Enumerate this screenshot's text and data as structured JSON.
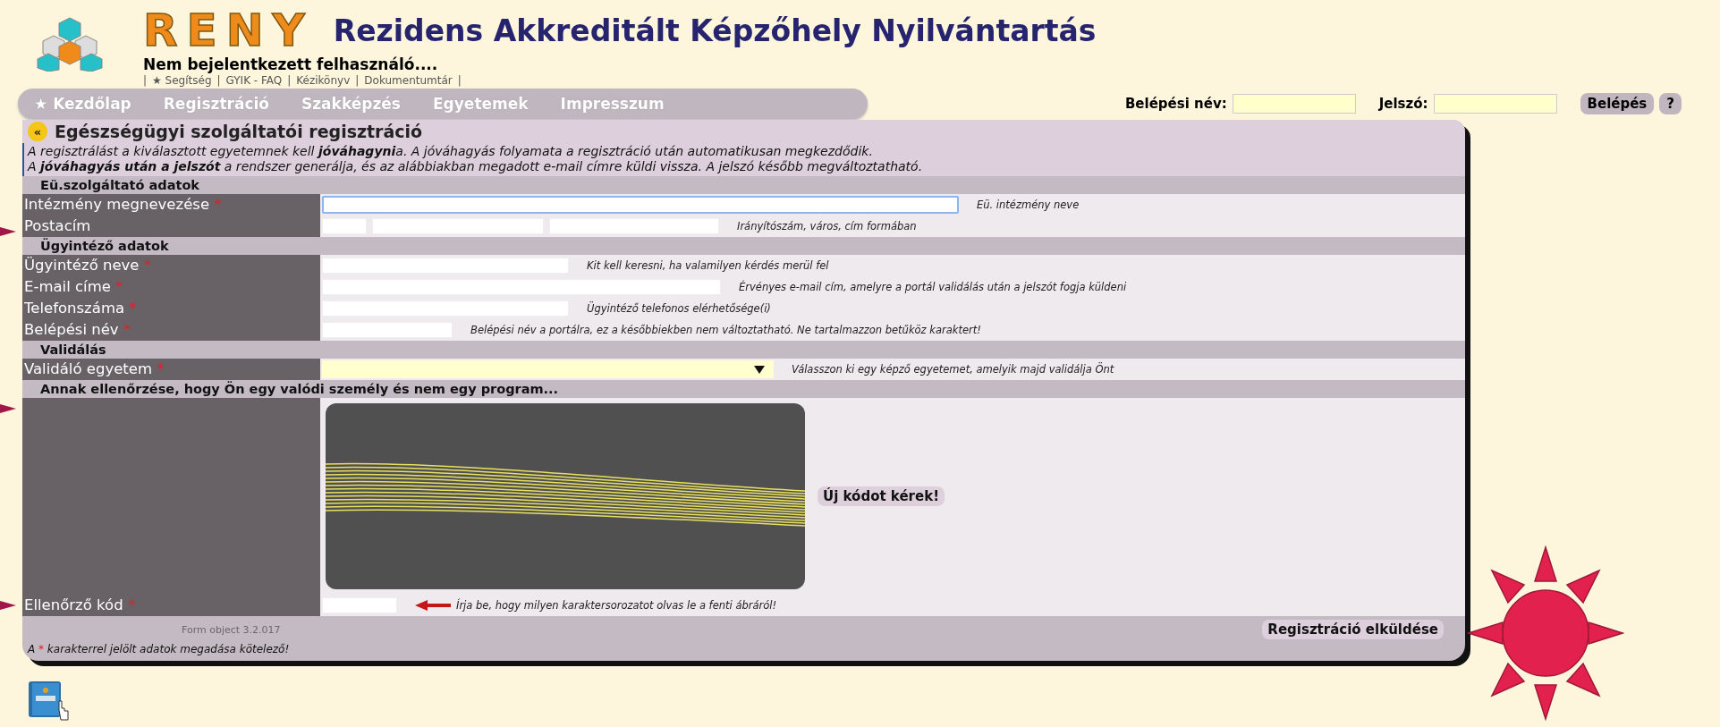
{
  "header": {
    "logo_text": "RENY",
    "title": "Rezidens Akkreditált Képzőhely Nyilvántartás",
    "user_status": "Nem bejelentkezett felhasználó....",
    "separator": "|",
    "links": [
      "★ Segítség",
      "GYIK - FAQ",
      "Kézikönyv",
      "Dokumentumtár"
    ]
  },
  "nav": [
    {
      "label": "★ Kezdőlap"
    },
    {
      "label": "Regisztráció"
    },
    {
      "label": "Szakképzés"
    },
    {
      "label": "Egyetemek"
    },
    {
      "label": "Impresszum"
    }
  ],
  "login": {
    "username_label": "Belépési név:",
    "password_label": "Jelszó:",
    "button": "Belépés",
    "help_button": "?"
  },
  "form": {
    "collapse_button": "«",
    "title": "Egészségügyi szolgáltatói regisztráció",
    "required_mark": "*",
    "intro": [
      "A regisztrálást a kiválasztott egyetemnek kell **jóváhagyni**a. A jóváhagyás folyamata a regisztráció után automatikusan megkezdődik.",
      "A **jóváhagyás után a jelszót** a rendszer generálja, és az alábbiakban megadott e-mail címre küldi vissza. A jelszó később megváltoztatható."
    ],
    "sections": [
      {
        "title": "Eü.szolgáltató adatok",
        "rows": [
          {
            "kind": "text",
            "label": "Intézmény megnevezése",
            "required": true,
            "focused": true,
            "hint": "Eü. intézmény neve"
          },
          {
            "kind": "address",
            "label": "Postacím",
            "required": false,
            "hint": "Irányítószám, város, cím formában"
          }
        ]
      },
      {
        "title": "Ügyintéző adatok",
        "rows": [
          {
            "kind": "text",
            "label": "Ügyintéző neve",
            "required": true,
            "focused": false,
            "hint": "Kit kell keresni, ha valamilyen kérdés merül fel"
          },
          {
            "kind": "text",
            "label": "E-mail címe",
            "required": true,
            "focused": false,
            "hint": "Érvényes e-mail cím, amelyre a portál validálás után a jelszót fogja küldeni"
          },
          {
            "kind": "text",
            "label": "Telefonszáma",
            "required": true,
            "focused": false,
            "hint": "Ügyintéző telefonos elérhetősége(i)"
          },
          {
            "kind": "text",
            "label": "Belépési név",
            "required": true,
            "focused": false,
            "hint": "Belépési név a portálra, ez a későbbiekben nem változtatható. Ne tartalmazzon betűköz karaktert!"
          }
        ]
      },
      {
        "title": "Validálás",
        "rows": [
          {
            "kind": "select",
            "label": "Validáló egyetem",
            "required": true,
            "hint": "Válasszon ki egy képző egyetemet, amelyik majd validálja Önt"
          }
        ]
      },
      {
        "title": "Annak ellenőrzése, hogy Ön egy valódi személy és nem egy program...",
        "rows": [
          {
            "kind": "captcha",
            "refresh_button": "Új kódot kérek!"
          },
          {
            "kind": "code",
            "label": "Ellenőrző kód",
            "required": true,
            "focused": false,
            "hint": "Írja be, hogy milyen karaktersorozatot olvas le a fenti ábráról!"
          }
        ]
      }
    ],
    "version": "Form object 3.2.017",
    "submit_button": "Regisztráció elküldése",
    "required_note": [
      "A",
      "karakterrel jelölt adatok megadása kötelező!"
    ]
  }
}
